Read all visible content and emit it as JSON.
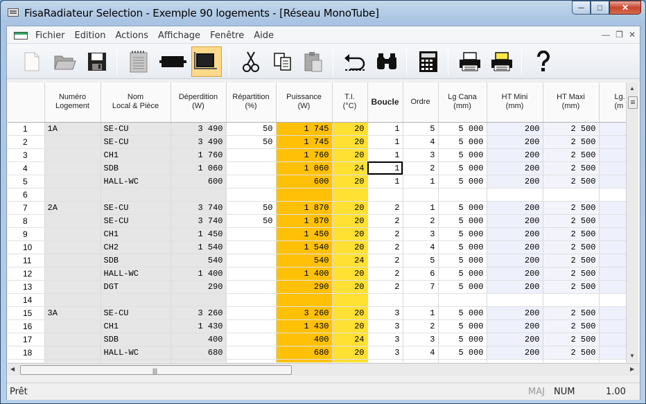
{
  "window": {
    "title": "FisaRadiateur Selection - Exemple 90 logements - [Réseau MonoTube]"
  },
  "menu": [
    "Fichier",
    "Edition",
    "Actions",
    "Affichage",
    "Fenêtre",
    "Aide"
  ],
  "toolbar": {
    "icons": [
      "new-file-icon",
      "open-folder-icon",
      "save-disk-icon",
      "notepad-icon",
      "black-rect-icon",
      "window-rect-icon",
      "scissors-icon",
      "copy-icon",
      "paste-icon",
      "undo-arrow-icon",
      "binoculars-icon",
      "calculator-icon",
      "printer-icon",
      "print-preview-icon",
      "help-question-icon"
    ],
    "active": "window-rect-icon"
  },
  "grid": {
    "headers": [
      {
        "line1": "",
        "line2": ""
      },
      {
        "line1": "Numéro",
        "line2": "Logement"
      },
      {
        "line1": "Nom",
        "line2": "Local & Pièce"
      },
      {
        "line1": "Déperdition",
        "line2": "(W)"
      },
      {
        "line1": "Répartition",
        "line2": "(%)"
      },
      {
        "line1": "Puissance",
        "line2": "(W)"
      },
      {
        "line1": "T.I.",
        "line2": "(°C)"
      },
      {
        "line1": "Boucle",
        "line2": ""
      },
      {
        "line1": "Ordre",
        "line2": ""
      },
      {
        "line1": "Lg Cana",
        "line2": "(mm)"
      },
      {
        "line1": "HT Mini",
        "line2": "(mm)"
      },
      {
        "line1": "HT Maxi",
        "line2": "(mm)"
      },
      {
        "line1": "Lg.",
        "line2": "(m"
      }
    ],
    "rows": [
      [
        "1",
        "1A",
        "SE-CU",
        "3 490",
        "50",
        "1 745",
        "20",
        "1",
        "5",
        "5 000",
        "200",
        "2 500"
      ],
      [
        "2",
        "",
        "SE-CU",
        "3 490",
        "50",
        "1 745",
        "20",
        "1",
        "4",
        "5 000",
        "200",
        "2 500"
      ],
      [
        "3",
        "",
        "CH1",
        "1 760",
        "",
        "1 760",
        "20",
        "1",
        "3",
        "5 000",
        "200",
        "2 500"
      ],
      [
        "4",
        "",
        "SDB",
        "1 060",
        "",
        "1 060",
        "24",
        "1",
        "2",
        "5 000",
        "200",
        "2 500"
      ],
      [
        "5",
        "",
        "HALL-WC",
        "600",
        "",
        "600",
        "20",
        "1",
        "1",
        "5 000",
        "200",
        "2 500"
      ],
      [
        "6",
        "",
        "",
        "",
        "",
        "",
        "",
        "",
        "",
        "",
        "",
        ""
      ],
      [
        "7",
        "2A",
        "SE-CU",
        "3 740",
        "50",
        "1 870",
        "20",
        "2",
        "1",
        "5 000",
        "200",
        "2 500"
      ],
      [
        "8",
        "",
        "SE-CU",
        "3 740",
        "50",
        "1 870",
        "20",
        "2",
        "2",
        "5 000",
        "200",
        "2 500"
      ],
      [
        "9",
        "",
        "CH1",
        "1 450",
        "",
        "1 450",
        "20",
        "2",
        "3",
        "5 000",
        "200",
        "2 500"
      ],
      [
        "10",
        "",
        "CH2",
        "1 540",
        "",
        "1 540",
        "20",
        "2",
        "4",
        "5 000",
        "200",
        "2 500"
      ],
      [
        "11",
        "",
        "SDB",
        "540",
        "",
        "540",
        "24",
        "2",
        "5",
        "5 000",
        "200",
        "2 500"
      ],
      [
        "12",
        "",
        "HALL-WC",
        "1 400",
        "",
        "1 400",
        "20",
        "2",
        "6",
        "5 000",
        "200",
        "2 500"
      ],
      [
        "13",
        "",
        "DGT",
        "290",
        "",
        "290",
        "20",
        "2",
        "7",
        "5 000",
        "200",
        "2 500"
      ],
      [
        "14",
        "",
        "",
        "",
        "",
        "",
        "",
        "",
        "",
        "",
        "",
        ""
      ],
      [
        "15",
        "3A",
        "SE-CU",
        "3 260",
        "",
        "3 260",
        "20",
        "3",
        "1",
        "5 000",
        "200",
        "2 500"
      ],
      [
        "16",
        "",
        "CH1",
        "1 430",
        "",
        "1 430",
        "20",
        "3",
        "2",
        "5 000",
        "200",
        "2 500"
      ],
      [
        "17",
        "",
        "SDB",
        "400",
        "",
        "400",
        "24",
        "3",
        "3",
        "5 000",
        "200",
        "2 500"
      ],
      [
        "18",
        "",
        "HALL-WC",
        "680",
        "",
        "680",
        "20",
        "3",
        "4",
        "5 000",
        "200",
        "2 500"
      ],
      [
        "19",
        "",
        "",
        "",
        "",
        "",
        "",
        "",
        "",
        "",
        "",
        ""
      ]
    ]
  },
  "status": {
    "text": "Prêt",
    "maj": "MAJ",
    "num": "NUM",
    "zoom": "1.00"
  },
  "colors": {
    "puissance": "#ffc107",
    "ti": "#ffe033",
    "gray": "#e6e6e6",
    "lavender": "#eef0fc"
  }
}
